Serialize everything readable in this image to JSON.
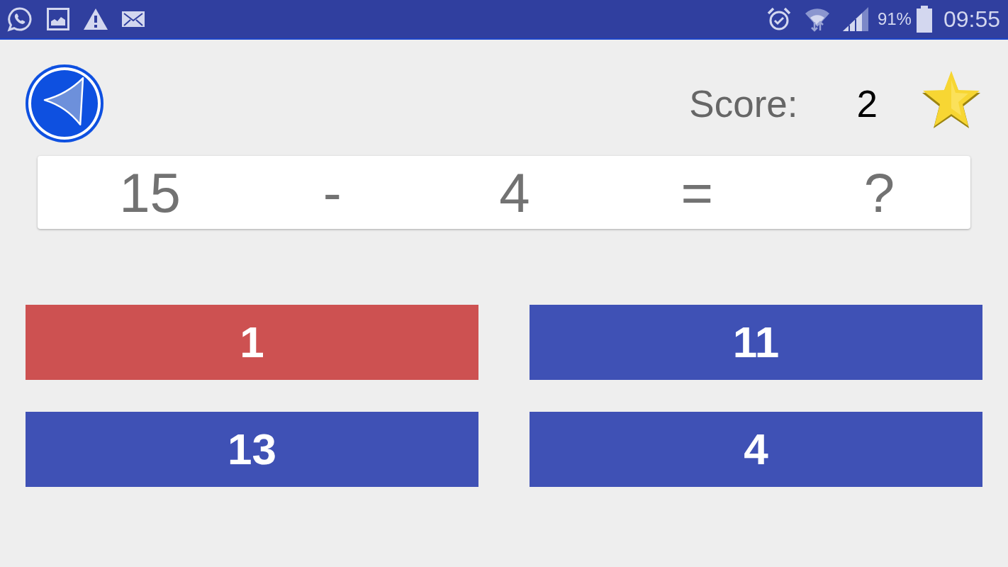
{
  "status_bar": {
    "battery": "91%",
    "time": "09:55"
  },
  "header": {
    "score_label": "Score:",
    "score_value": "2"
  },
  "equation": [
    "15",
    "-",
    "4",
    "=",
    "?"
  ],
  "answers": [
    {
      "label": "1",
      "wrong": true
    },
    {
      "label": "11",
      "wrong": false
    },
    {
      "label": "13",
      "wrong": false
    },
    {
      "label": "4",
      "wrong": false
    }
  ]
}
